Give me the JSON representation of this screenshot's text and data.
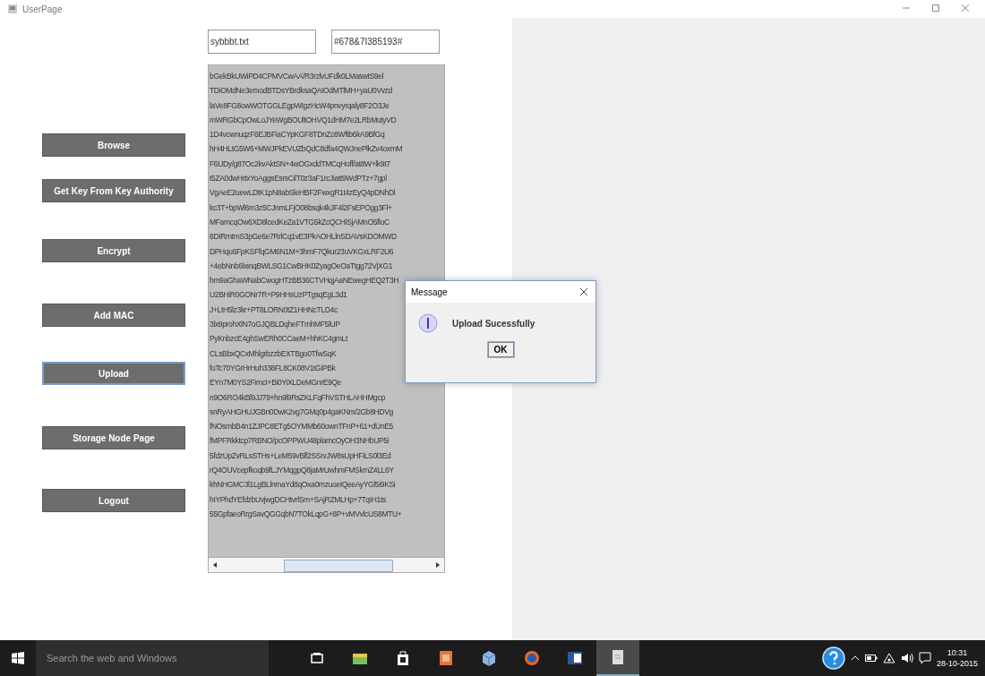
{
  "window": {
    "title": "UserPage"
  },
  "buttons": [
    {
      "label": "Browse",
      "focused": false
    },
    {
      "label": "Get Key From Key Authority",
      "focused": false
    },
    {
      "label": "Encrypt",
      "focused": false
    },
    {
      "label": "Add MAC",
      "focused": false
    },
    {
      "label": "Upload",
      "focused": true
    },
    {
      "label": "Storage Node Page",
      "focused": false
    },
    {
      "label": "Logout",
      "focused": false
    }
  ],
  "file_field": {
    "value": "sybbbt.txt"
  },
  "key_field": {
    "value": "#678&7I385193#"
  },
  "text_area": {
    "lines": [
      "bGekBkUWiPD4CPMVCwAA/R3rzlvUFdk0LMaswtS9el",
      "TDiOMdNe3emodBTDsYBrdksaQAIOdMTlMH+yaU0Vvzd",
      "laVe8FG8owWOTGGLEgpWIgzHcW4pnvyrqaly8F2O3Je",
      "mWRGbCpOwLoJYeWgBOUltOHVQ1dHM7e2LRbMutyVD",
      "1D4vcwnuqzF6EJBFiaCYpKGF8TDnZc8Wftb6kA9BfGq",
      "hH4HLtG5W6+MWJPkEVUZbQdC8dfa4QWJnePlkZv4oxmM",
      "F6UDy/g87Oc2kvAktSN+4wOGxddTMCqHoff/at8W+lk9t7",
      "t5ZA0dwHrtxYoAggsEsrsCilT0z3aF1rcJiatt9WdPTz+7gpl",
      "VgAeE2uewLDtK1pN8abSleHBF2FwxgR1t4zEyQ4pDNhDl",
      "kc3T+bpWl6m3z5CJnmLFjO08bsqk4kJF4l2FsEPOgg3Fl+",
      "MFamcqOw6XD8lcedKeZa1VTG5kZcQCHlSjAMnO5floC",
      "6DIRmtmS3pGe6e7RrlCq1vE3PkAOHLlnSDAVsKDOMWD",
      "DPHqu6FpKSFfqGM6N1M+3hmF7Qkur23uVKGxLRF2U6",
      "+4ebNnb6lxinqBWLSG1CwBHK0ZyagOeOaTtgg72VjXG1",
      "hm9aGhaWNabCwogHTzBB36CTVHqjAaNEwegHEQ2T3H",
      "U2BHiR0GONr7R+P9HHsUzPTgsqEgL3d1",
      "J+LtH5lz3kr+PT8LORN0tZ1HHNcTLD4c",
      "3lx9prohXlN7oGJQBLDqheFTmhMF5lUP",
      "PyKnbzcE4ghSwERh0CCaeM+hhKC4gmLt",
      "CLsBbxQCxMhlgrbzzbEXTBgo0TfwSqK",
      "foTc70YGrHrHuh338FL8CK08V1tGiPBk",
      "EYn7M0YS2FimcI+Bi0YiXLDeMGnrE9Qe",
      "n9O6RO4kBl9JJ79+hn9l9RsZKLFqFhVSTHLAHHMgcp",
      "snRyAHGHUJGBn0DwK2vg7GMq0p4gaKNm/2Gb8HDVg",
      "fNOsmbB4n1ZJPC8ETg5OYMMb60ownTFnP+61+dUnE5",
      "fMPFRkktcp7RBNO/pcOPPWU48plamcOyOH3NHbUP5i",
      "5fdzUpZvRLsSTHs+LeM59vBlf2SSrvJW8sUpHFiLS0l3Ed",
      "rQ4OUVcepfkoqb9fLJYMqgpQ8jaMrUwhmFMSkmZ4LL6Y",
      "khNHGMC3l1LgBLlnmaYd8qOxa0rnzuoeIQeeAyYGl5i9KSi",
      "hIYPhdYEfdzbUvjwgDCHtvrlSm+SAjRZMLHp+7TqIH1ts",
      "55GpfaeoRrgSavQGGqbN7TOkLqpG+8P+vMVvlcUS8MTU+"
    ]
  },
  "dialog": {
    "title": "Message",
    "message": "Upload Sucessfully",
    "button": "OK"
  },
  "taskbar": {
    "search_placeholder": "Search the web and Windows",
    "apps": [
      {
        "kind": "taskview",
        "active": false
      },
      {
        "kind": "folder",
        "active": false
      },
      {
        "kind": "store",
        "active": false
      },
      {
        "kind": "office",
        "active": false
      },
      {
        "kind": "box",
        "active": false
      },
      {
        "kind": "browser",
        "active": false
      },
      {
        "kind": "word",
        "active": false
      },
      {
        "kind": "java",
        "active": true
      }
    ],
    "time": "10:31",
    "date": "28-10-2015"
  }
}
